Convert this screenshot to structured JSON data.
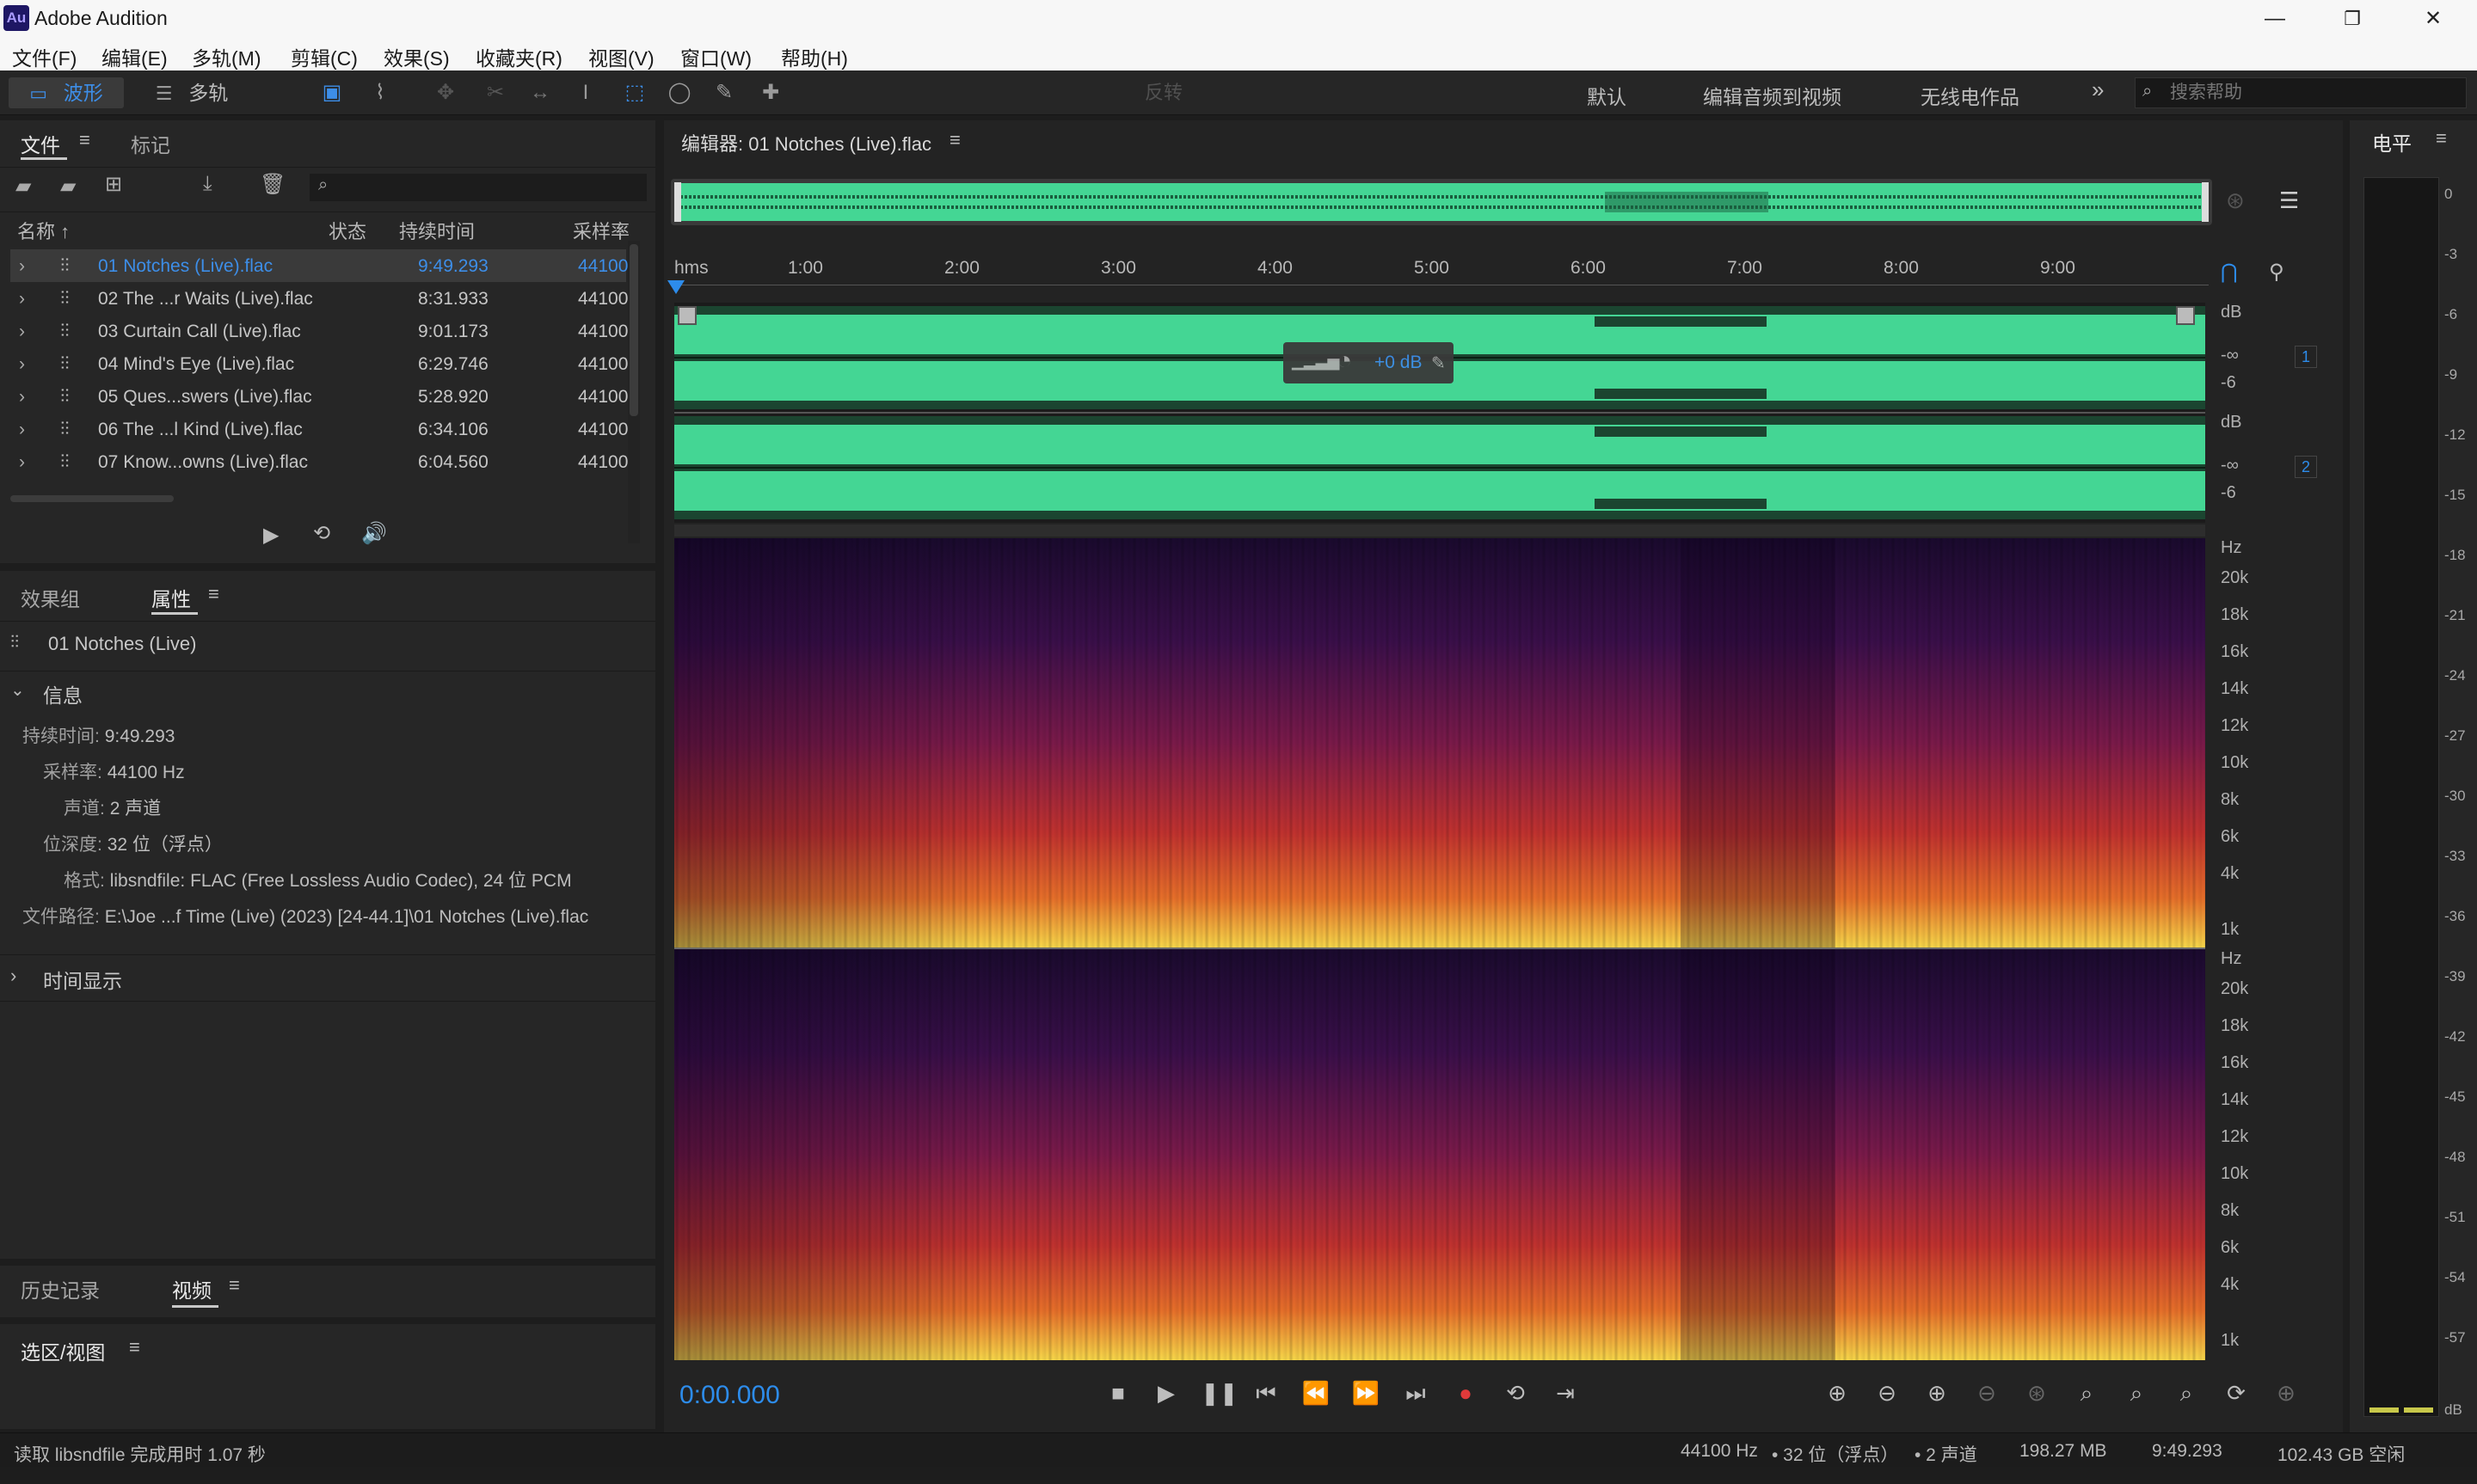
{
  "app": {
    "icon_text": "Au",
    "title": "Adobe Audition"
  },
  "window": {
    "minimize": "—",
    "restore": "❐",
    "close": "✕"
  },
  "menu": [
    "文件(F)",
    "编辑(E)",
    "多轨(M)",
    "剪辑(C)",
    "效果(S)",
    "收藏夹(R)",
    "视图(V)",
    "窗口(W)",
    "帮助(H)"
  ],
  "toolbar": {
    "waveform_label": "波形",
    "multitrack_label": "多轨",
    "feedback": "反转",
    "workspaces": [
      "默认",
      "编辑音频到视频",
      "无线电作品"
    ],
    "more": "»",
    "search_placeholder": "搜索帮助"
  },
  "files_panel": {
    "tab_files": "文件",
    "tab_markers": "标记",
    "col_name": "名称 ↑",
    "col_state": "状态",
    "col_duration": "持续时间",
    "col_rate": "采样率",
    "rows": [
      {
        "name": "01 Notches (Live).flac",
        "duration": "9:49.293",
        "rate": "44100"
      },
      {
        "name": "02 The ...r Waits (Live).flac",
        "duration": "8:31.933",
        "rate": "44100"
      },
      {
        "name": "03 Curtain Call (Live).flac",
        "duration": "9:01.173",
        "rate": "44100"
      },
      {
        "name": "04 Mind's Eye (Live).flac",
        "duration": "6:29.746",
        "rate": "44100"
      },
      {
        "name": "05 Ques...swers (Live).flac",
        "duration": "5:28.920",
        "rate": "44100"
      },
      {
        "name": "06 The ...l Kind (Live).flac",
        "duration": "6:34.106",
        "rate": "44100"
      },
      {
        "name": "07 Know...owns (Live).flac",
        "duration": "6:04.560",
        "rate": "44100"
      }
    ]
  },
  "props_panel": {
    "tab_effects": "效果组",
    "tab_props": "属性",
    "clip_name": "01 Notches (Live)",
    "section_info": "信息",
    "info": [
      {
        "label": "持续时间:",
        "value": "9:49.293"
      },
      {
        "label": "采样率:",
        "value": "44100 Hz"
      },
      {
        "label": "声道:",
        "value": "2 声道"
      },
      {
        "label": "位深度:",
        "value": "32 位（浮点）"
      },
      {
        "label": "格式:",
        "value": "libsndfile: FLAC (Free Lossless Audio Codec), 24 位 PCM"
      },
      {
        "label": "文件路径:",
        "value": "E:\\Joe ...f Time (Live) (2023) [24-44.1]\\01 Notches (Live).flac"
      }
    ],
    "section_time": "时间显示"
  },
  "history_panel": {
    "tab_history": "历史记录",
    "tab_video": "视频"
  },
  "selection_panel": {
    "title": "选区/视图"
  },
  "editor": {
    "title": "编辑器: 01 Notches (Live).flac",
    "ruler_unit": "hms",
    "ruler_ticks": [
      "1:00",
      "2:00",
      "3:00",
      "4:00",
      "5:00",
      "6:00",
      "7:00",
      "8:00",
      "9:00"
    ],
    "hud_value": "+0 dB",
    "db_label": "dB",
    "db_inf": "-∞",
    "db_6": "-6",
    "ch1": "1",
    "ch2": "2",
    "hz_label": "Hz",
    "hz_ticks": [
      "20k",
      "18k",
      "16k",
      "14k",
      "12k",
      "10k",
      "8k",
      "6k",
      "4k",
      "1k"
    ],
    "timecode": "0:00.000"
  },
  "meter": {
    "title": "电平",
    "ticks": [
      "0",
      "-3",
      "-6",
      "-9",
      "-12",
      "-15",
      "-18",
      "-21",
      "-24",
      "-27",
      "-30",
      "-33",
      "-36",
      "-39",
      "-42",
      "-45",
      "-48",
      "-51",
      "-54",
      "-57",
      "dB"
    ]
  },
  "status": {
    "left": "读取 libsndfile 完成用时 1.07 秒",
    "rate": "44100 Hz",
    "depth": "• 32 位（浮点）",
    "channels": "• 2 声道",
    "size": "198.27 MB",
    "duration": "9:49.293",
    "free": "102.43 GB 空闲"
  },
  "colors": {
    "waveform": "#44d694",
    "accent": "#2d8ceb",
    "timecode": "#2d8ceb"
  }
}
